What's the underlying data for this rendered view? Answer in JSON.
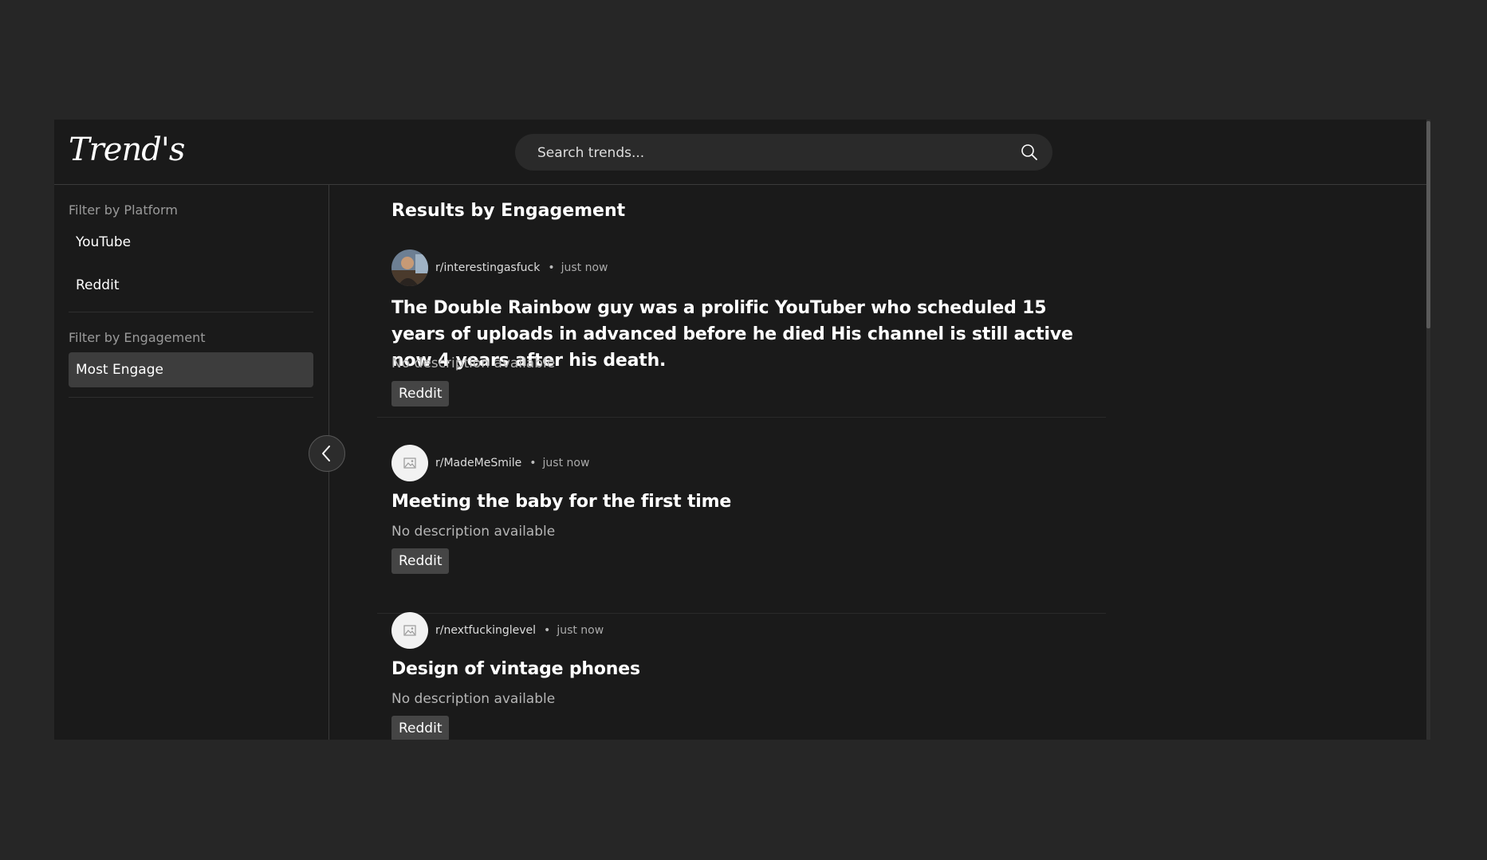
{
  "app": {
    "logo": "Trend's"
  },
  "search": {
    "placeholder": "Search trends...",
    "icon": "search-icon"
  },
  "sidebar": {
    "platform_title": "Filter by Platform",
    "platforms": [
      "YouTube",
      "Reddit"
    ],
    "engagement_title": "Filter by Engagement",
    "engagement_items": [
      "Most Engage"
    ],
    "active_engagement": "Most Engage",
    "collapse_icon": "chevron-left-icon"
  },
  "main": {
    "title": "Results by Engagement",
    "posts": [
      {
        "subreddit": "r/interestingasfuck",
        "separator": "•",
        "time": "just now",
        "title": "The Double Rainbow guy was a prolific YouTuber who scheduled 15 years of uploads in advanced before he died His channel is still active now 4 years after his death.",
        "description": "No description available",
        "platform": "Reddit",
        "avatar": "photo"
      },
      {
        "subreddit": "r/MadeMeSmile",
        "separator": "•",
        "time": "just now",
        "title": "Meeting the baby for the first time",
        "description": "No description available",
        "platform": "Reddit",
        "avatar": "image-placeholder-icon"
      },
      {
        "subreddit": "r/nextfuckinglevel",
        "separator": "•",
        "time": "just now",
        "title": "Design of vintage phones",
        "description": "No description available",
        "platform": "Reddit",
        "avatar": "image-placeholder-icon"
      }
    ]
  },
  "colors": {
    "background": "#262626",
    "panel": "#1a1a1a",
    "search_bg": "#2a2a2a",
    "active_filter": "#3d3d3d",
    "badge": "#454545"
  }
}
